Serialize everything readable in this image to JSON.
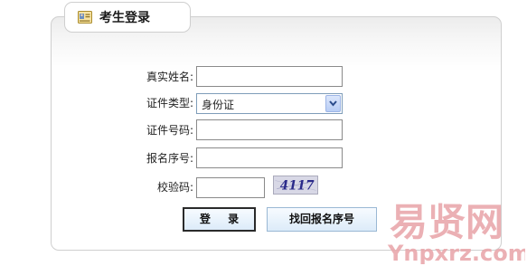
{
  "header": {
    "title": "考生登录",
    "icon": "id-card-icon"
  },
  "form": {
    "name_label": "真实姓名:",
    "name_value": "",
    "idtype_label": "证件类型:",
    "idtype_selected": "身份证",
    "idnumber_label": "证件号码:",
    "idnumber_value": "",
    "regno_label": "报名序号:",
    "regno_value": "",
    "captcha_label": "校验码:",
    "captcha_value": "",
    "captcha_text": "4117"
  },
  "buttons": {
    "login": "登 录",
    "find_regno": "找回报名序号"
  },
  "watermark": {
    "title": "易贤网",
    "url": "Ynpxrz.com"
  },
  "colors": {
    "border": "#cfcfcf",
    "watermark": "#e9a8ac",
    "button_bg": "#dcebf9",
    "select_arrow": "#b8cdf5"
  }
}
